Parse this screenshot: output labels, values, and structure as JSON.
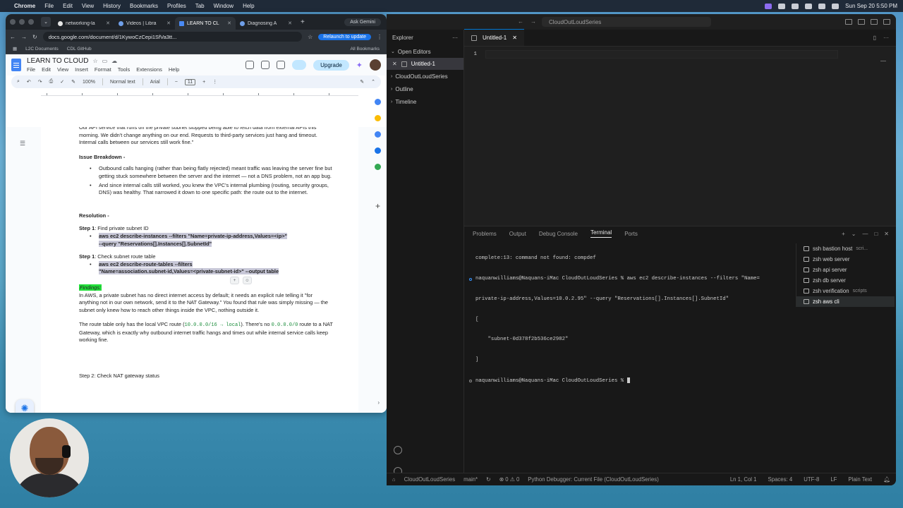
{
  "menubar": {
    "app": "Chrome",
    "items": [
      "File",
      "Edit",
      "View",
      "History",
      "Bookmarks",
      "Profiles",
      "Tab",
      "Window",
      "Help"
    ],
    "datetime": "Sun Sep 20  5:50 PM"
  },
  "chrome": {
    "tabs": [
      {
        "label": "networking-la"
      },
      {
        "label": "Videos | Libra"
      },
      {
        "label": "LEARN TO CL"
      },
      {
        "label": "Diagnosing A"
      }
    ],
    "ask_label": "Ask Gemini",
    "url": "docs.google.com/document/d/1KywoCzCepi1SfVa3tt...",
    "relaunch_label": "Relaunch to update",
    "bookmarks": [
      "L2C Documents",
      "CDL GitHub"
    ],
    "all_bookmarks": "All Bookmarks"
  },
  "docs": {
    "title": "LEARN TO CLOUD",
    "menu": [
      "File",
      "Edit",
      "View",
      "Insert",
      "Format",
      "Tools",
      "Extensions",
      "Help"
    ],
    "upgrade_label": "Upgrade",
    "format": {
      "zoom": "100%",
      "style": "Normal text",
      "font": "Arial",
      "size": "11"
    },
    "intro": "Our API service that runs on the private subnet stopped being able to fetch data from external APIs this morning. We didn't change anything on our end. Requests to third-party services just hang and timeout. Internal calls between our services still work fine.\"",
    "issue_heading": "Issue Breakdown -",
    "bullets": [
      "Outbound calls hanging (rather than being flatly rejected) meant traffic was leaving the server fine but getting stuck somewhere between the server and the internet — not a DNS problem, not an app bug.",
      "And since internal calls still worked, you knew the VPC's internal plumbing (routing, security groups, DNS) was healthy. That narrowed it down to one specific path: the route out to the internet."
    ],
    "resolution_heading": "Resolution -",
    "step1_label": "Step 1",
    "step1_text": ": Find private subnet ID",
    "step1_cmd_a": "aws ec2 describe-instances --filters \"Name=private-ip-address,Values=<ip>\"",
    "step1_cmd_b": "--query \"Reservations[].Instances[].SubnetId\"",
    "step2_label": "Step 1",
    "step2_text": ": Check subnet route table",
    "step2_cmd_a": "aws ec2 describe-route-tables --filters",
    "step2_cmd_b": "\"Name=association.subnet-id,Values=<private-subnet-id>\" --output table",
    "findings_label": "Findings:",
    "findings_text": "In AWS, a private subnet has no direct internet access by default; it needs an explicit rule telling it \"for anything not in our own network, send it to the NAT Gateway.\" You found that rule was simply missing — the subnet only knew how to reach other things inside the VPC, nothing outside it.",
    "route_text_a": "The route table only has the local VPC route (",
    "route_code_a": "10.0.0.0/16 → local",
    "route_text_b": "). There's no ",
    "route_code_b": "0.0.0.0/0",
    "route_text_c": " route to a NAT Gateway, which is exactly why outbound internet traffic hangs and times out while internal service calls keep working fine.",
    "step2_cut": "Step 2: Check NAT gateway status"
  },
  "vscode": {
    "search_label": "CloudOutLoudSeries",
    "explorer_label": "Explorer",
    "sections": {
      "open_editors": "Open Editors",
      "folder": "CloudOutLoudSeries",
      "outline": "Outline",
      "timeline": "Timeline"
    },
    "open_file": "Untitled-1",
    "tab_label": "Untitled-1",
    "line_number": "1",
    "panel_tabs": [
      "Problems",
      "Output",
      "Debug Console",
      "Terminal",
      "Ports"
    ],
    "terminal_lines": [
      "complete:13: command not found: compdef",
      "naquanwilliams@Naquans-iMac CloudOutLoudSeries % aws ec2 describe-instances --filters \"Name=",
      "private-ip-address,Values=10.0.2.95\" --query \"Reservations[].Instances[].SubnetId\"",
      "[",
      "    \"subnet-0d378f2b536ce2982\"",
      "]",
      "naquanwilliams@Naquans-iMac CloudOutLoudSeries % "
    ],
    "terminals": [
      {
        "label": "ssh bastion host",
        "sub": "scri..."
      },
      {
        "label": "zsh web server",
        "sub": ""
      },
      {
        "label": "zsh api server",
        "sub": ""
      },
      {
        "label": "zsh db server",
        "sub": ""
      },
      {
        "label": "zsh verification",
        "sub": "scripts"
      },
      {
        "label": "zsh aws cli",
        "sub": ""
      }
    ],
    "status": {
      "folder": "CloudOutLoudSeries",
      "branch": "main*",
      "errors": "⊗ 0 ⚠ 0",
      "debugger": "Python Debugger: Current File (CloudOutLoudSeries)",
      "position": "Ln 1, Col 1",
      "spaces": "Spaces: 4",
      "encoding": "UTF-8",
      "eol": "LF",
      "language": "Plain Text"
    }
  },
  "colors": {
    "accent": "#1a73e8",
    "findings_highlight": "#22e03a",
    "selection": "#c8c8d8",
    "vscode_bg": "#181818"
  }
}
